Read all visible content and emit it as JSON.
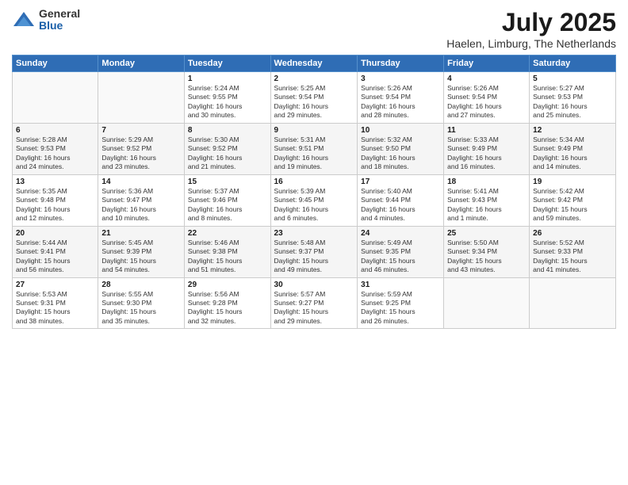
{
  "logo": {
    "general": "General",
    "blue": "Blue"
  },
  "title": "July 2025",
  "subtitle": "Haelen, Limburg, The Netherlands",
  "weekdays": [
    "Sunday",
    "Monday",
    "Tuesday",
    "Wednesday",
    "Thursday",
    "Friday",
    "Saturday"
  ],
  "weeks": [
    [
      {
        "day": "",
        "content": ""
      },
      {
        "day": "",
        "content": ""
      },
      {
        "day": "1",
        "content": "Sunrise: 5:24 AM\nSunset: 9:55 PM\nDaylight: 16 hours\nand 30 minutes."
      },
      {
        "day": "2",
        "content": "Sunrise: 5:25 AM\nSunset: 9:54 PM\nDaylight: 16 hours\nand 29 minutes."
      },
      {
        "day": "3",
        "content": "Sunrise: 5:26 AM\nSunset: 9:54 PM\nDaylight: 16 hours\nand 28 minutes."
      },
      {
        "day": "4",
        "content": "Sunrise: 5:26 AM\nSunset: 9:54 PM\nDaylight: 16 hours\nand 27 minutes."
      },
      {
        "day": "5",
        "content": "Sunrise: 5:27 AM\nSunset: 9:53 PM\nDaylight: 16 hours\nand 25 minutes."
      }
    ],
    [
      {
        "day": "6",
        "content": "Sunrise: 5:28 AM\nSunset: 9:53 PM\nDaylight: 16 hours\nand 24 minutes."
      },
      {
        "day": "7",
        "content": "Sunrise: 5:29 AM\nSunset: 9:52 PM\nDaylight: 16 hours\nand 23 minutes."
      },
      {
        "day": "8",
        "content": "Sunrise: 5:30 AM\nSunset: 9:52 PM\nDaylight: 16 hours\nand 21 minutes."
      },
      {
        "day": "9",
        "content": "Sunrise: 5:31 AM\nSunset: 9:51 PM\nDaylight: 16 hours\nand 19 minutes."
      },
      {
        "day": "10",
        "content": "Sunrise: 5:32 AM\nSunset: 9:50 PM\nDaylight: 16 hours\nand 18 minutes."
      },
      {
        "day": "11",
        "content": "Sunrise: 5:33 AM\nSunset: 9:49 PM\nDaylight: 16 hours\nand 16 minutes."
      },
      {
        "day": "12",
        "content": "Sunrise: 5:34 AM\nSunset: 9:49 PM\nDaylight: 16 hours\nand 14 minutes."
      }
    ],
    [
      {
        "day": "13",
        "content": "Sunrise: 5:35 AM\nSunset: 9:48 PM\nDaylight: 16 hours\nand 12 minutes."
      },
      {
        "day": "14",
        "content": "Sunrise: 5:36 AM\nSunset: 9:47 PM\nDaylight: 16 hours\nand 10 minutes."
      },
      {
        "day": "15",
        "content": "Sunrise: 5:37 AM\nSunset: 9:46 PM\nDaylight: 16 hours\nand 8 minutes."
      },
      {
        "day": "16",
        "content": "Sunrise: 5:39 AM\nSunset: 9:45 PM\nDaylight: 16 hours\nand 6 minutes."
      },
      {
        "day": "17",
        "content": "Sunrise: 5:40 AM\nSunset: 9:44 PM\nDaylight: 16 hours\nand 4 minutes."
      },
      {
        "day": "18",
        "content": "Sunrise: 5:41 AM\nSunset: 9:43 PM\nDaylight: 16 hours\nand 1 minute."
      },
      {
        "day": "19",
        "content": "Sunrise: 5:42 AM\nSunset: 9:42 PM\nDaylight: 15 hours\nand 59 minutes."
      }
    ],
    [
      {
        "day": "20",
        "content": "Sunrise: 5:44 AM\nSunset: 9:41 PM\nDaylight: 15 hours\nand 56 minutes."
      },
      {
        "day": "21",
        "content": "Sunrise: 5:45 AM\nSunset: 9:39 PM\nDaylight: 15 hours\nand 54 minutes."
      },
      {
        "day": "22",
        "content": "Sunrise: 5:46 AM\nSunset: 9:38 PM\nDaylight: 15 hours\nand 51 minutes."
      },
      {
        "day": "23",
        "content": "Sunrise: 5:48 AM\nSunset: 9:37 PM\nDaylight: 15 hours\nand 49 minutes."
      },
      {
        "day": "24",
        "content": "Sunrise: 5:49 AM\nSunset: 9:35 PM\nDaylight: 15 hours\nand 46 minutes."
      },
      {
        "day": "25",
        "content": "Sunrise: 5:50 AM\nSunset: 9:34 PM\nDaylight: 15 hours\nand 43 minutes."
      },
      {
        "day": "26",
        "content": "Sunrise: 5:52 AM\nSunset: 9:33 PM\nDaylight: 15 hours\nand 41 minutes."
      }
    ],
    [
      {
        "day": "27",
        "content": "Sunrise: 5:53 AM\nSunset: 9:31 PM\nDaylight: 15 hours\nand 38 minutes."
      },
      {
        "day": "28",
        "content": "Sunrise: 5:55 AM\nSunset: 9:30 PM\nDaylight: 15 hours\nand 35 minutes."
      },
      {
        "day": "29",
        "content": "Sunrise: 5:56 AM\nSunset: 9:28 PM\nDaylight: 15 hours\nand 32 minutes."
      },
      {
        "day": "30",
        "content": "Sunrise: 5:57 AM\nSunset: 9:27 PM\nDaylight: 15 hours\nand 29 minutes."
      },
      {
        "day": "31",
        "content": "Sunrise: 5:59 AM\nSunset: 9:25 PM\nDaylight: 15 hours\nand 26 minutes."
      },
      {
        "day": "",
        "content": ""
      },
      {
        "day": "",
        "content": ""
      }
    ]
  ]
}
